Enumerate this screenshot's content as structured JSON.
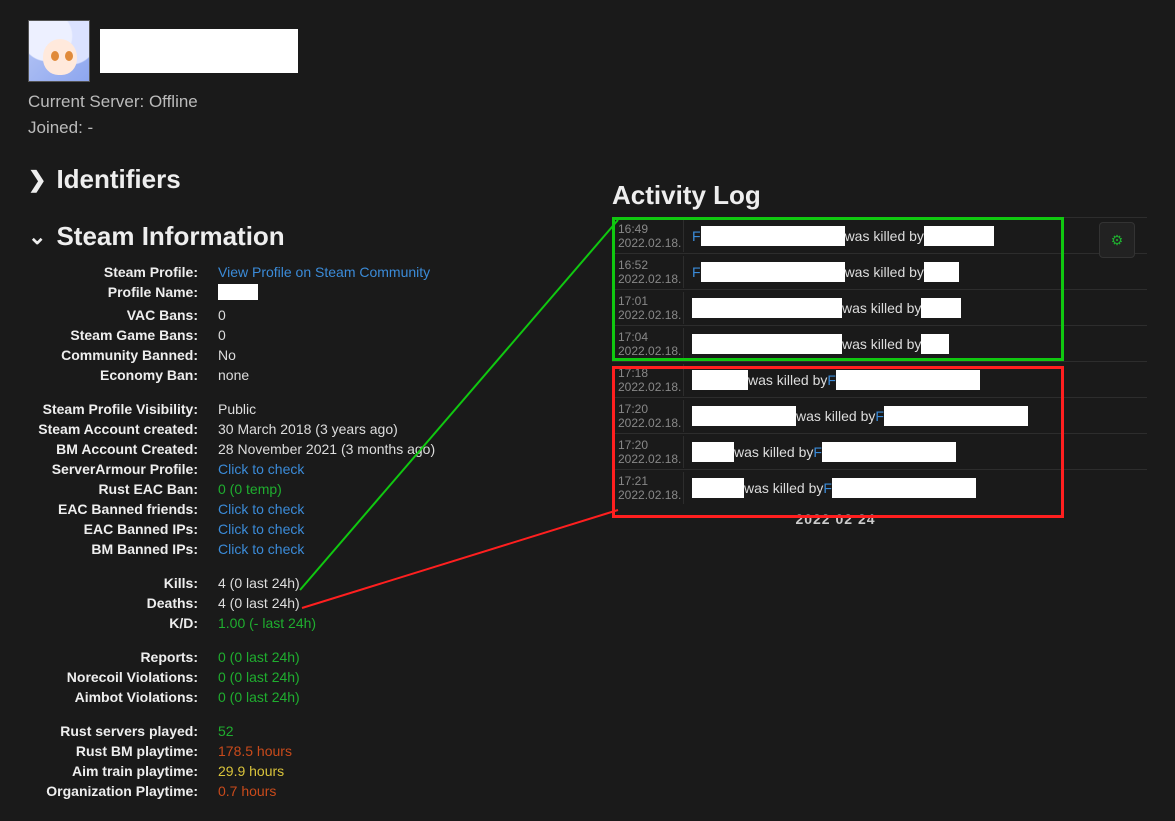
{
  "header": {
    "currentServerLabel": "Current Server: ",
    "currentServerValue": "Offline",
    "joinedLabel": "Joined: ",
    "joinedValue": "-"
  },
  "sections": {
    "identifiers": "Identifiers",
    "steamInfo": "Steam Information",
    "activityLog": "Activity Log"
  },
  "steam": [
    {
      "label": "Steam Profile:",
      "value": "View Profile on Steam Community",
      "cls": "link"
    },
    {
      "label": "Profile Name:",
      "value": "",
      "redactW": 40
    },
    {
      "label": "VAC Bans:",
      "value": "0"
    },
    {
      "label": "Steam Game Bans:",
      "value": "0"
    },
    {
      "label": "Community Banned:",
      "value": "No"
    },
    {
      "label": "Economy Ban:",
      "value": "none"
    }
  ],
  "steam2": [
    {
      "label": "Steam Profile Visibility:",
      "value": "Public"
    },
    {
      "label": "Steam Account created:",
      "value": "30 March 2018 (3 years ago)"
    },
    {
      "label": "BM Account Created:",
      "value": "28 November 2021 (3 months ago)"
    },
    {
      "label": "ServerArmour Profile:",
      "value": "Click to check",
      "cls": "link"
    },
    {
      "label": "Rust EAC Ban:",
      "value": "0 (0 temp)",
      "cls": "green"
    },
    {
      "label": "EAC Banned friends:",
      "value": "Click to check",
      "cls": "link"
    },
    {
      "label": "EAC Banned IPs:",
      "value": "Click to check",
      "cls": "link"
    },
    {
      "label": "BM Banned IPs:",
      "value": "Click to check",
      "cls": "link"
    }
  ],
  "stats": [
    {
      "label": "Kills:",
      "value": "4 (0 last 24h)"
    },
    {
      "label": "Deaths:",
      "value": "4 (0 last 24h)"
    },
    {
      "label": "K/D:",
      "value": "1.00 (- last 24h)",
      "cls": "green"
    }
  ],
  "stats2": [
    {
      "label": "Reports:",
      "value": "0 (0 last 24h)",
      "cls": "green"
    },
    {
      "label": "Norecoil Violations:",
      "value": "0 (0 last 24h)",
      "cls": "green"
    },
    {
      "label": "Aimbot Violations:",
      "value": "0 (0 last 24h)",
      "cls": "green"
    }
  ],
  "stats3": [
    {
      "label": "Rust servers played:",
      "value": "52",
      "cls": "green"
    },
    {
      "label": "Rust BM playtime:",
      "value": "178.5 hours",
      "cls": "orange"
    },
    {
      "label": "Aim train playtime:",
      "value": "29.9 hours",
      "cls": "yellow"
    },
    {
      "label": "Organization Playtime:",
      "value": "0.7 hours",
      "cls": "orange"
    }
  ],
  "log": {
    "green": [
      {
        "t": "16:49",
        "d": "2022.02.18.",
        "flink": "F",
        "r1w": 144,
        "txt": "was killed by",
        "r2w": 70
      },
      {
        "t": "16:52",
        "d": "2022.02.18.",
        "flink": "F",
        "r1w": 144,
        "txt": "was killed by",
        "r2w": 35
      },
      {
        "t": "17:01",
        "d": "2022.02.18.",
        "flink": "",
        "r1w": 150,
        "txt": "was killed by",
        "r2w": 40
      },
      {
        "t": "17:04",
        "d": "2022.02.18.",
        "flink": "",
        "r1w": 150,
        "txt": "was killed by",
        "r2w": 28
      }
    ],
    "red": [
      {
        "t": "17:18",
        "d": "2022.02.18.",
        "r1w": 56,
        "txt": "was killed by",
        "flink": "F",
        "r2w": 144
      },
      {
        "t": "17:20",
        "d": "2022.02.18.",
        "r1w": 104,
        "txt": "was killed by",
        "flink": "F",
        "r2w": 144
      },
      {
        "t": "17:20",
        "d": "2022.02.18.",
        "r1w": 42,
        "txt": "was killed by",
        "flink": "F",
        "r2w": 134
      },
      {
        "t": "17:21",
        "d": "2022.02.18.",
        "r1w": 52,
        "txt": "was killed by",
        "flink": "F",
        "r2w": 144
      }
    ],
    "nextDate": "2022 02 24"
  }
}
